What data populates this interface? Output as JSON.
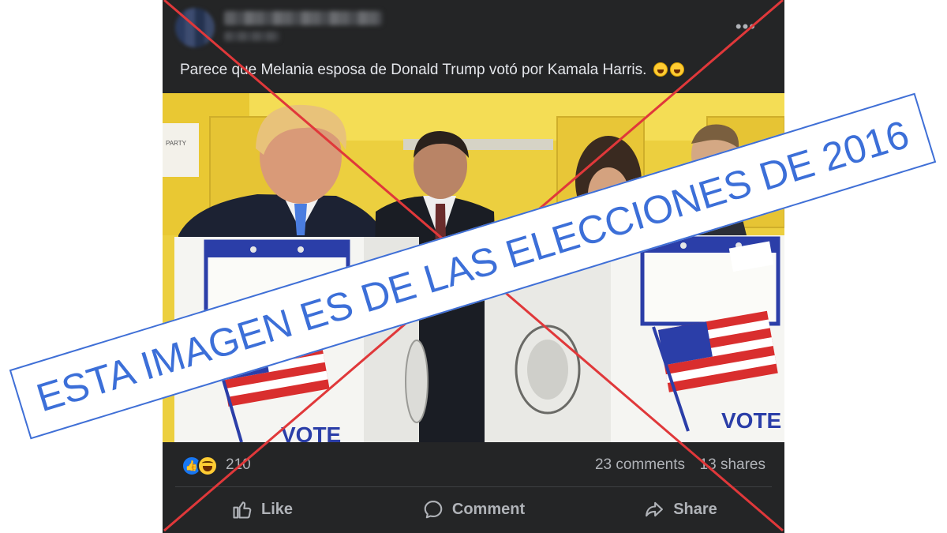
{
  "post": {
    "text": "Parece que Melania esposa de Donald Trump votó por Kamala Harris. ",
    "more_icon": "more-horizontal-icon",
    "more_glyph": "•••"
  },
  "photo": {
    "description_items": [
      "voting-booth-left",
      "voting-booth-right",
      "man-in-suit",
      "woman",
      "security-agent",
      "american-flag"
    ],
    "booth_label": "VOTE",
    "sign_text": "PARTY"
  },
  "stats": {
    "reaction_count": "210",
    "comments": "23 comments",
    "shares": "13 shares"
  },
  "actions": {
    "like": "Like",
    "comment": "Comment",
    "share": "Share"
  },
  "overlay": {
    "banner_text": "ESTA IMAGEN ES DE LAS ELECCIONES DE 2016",
    "cross_color": "#e0383a",
    "banner_color": "#3c6fd8"
  }
}
